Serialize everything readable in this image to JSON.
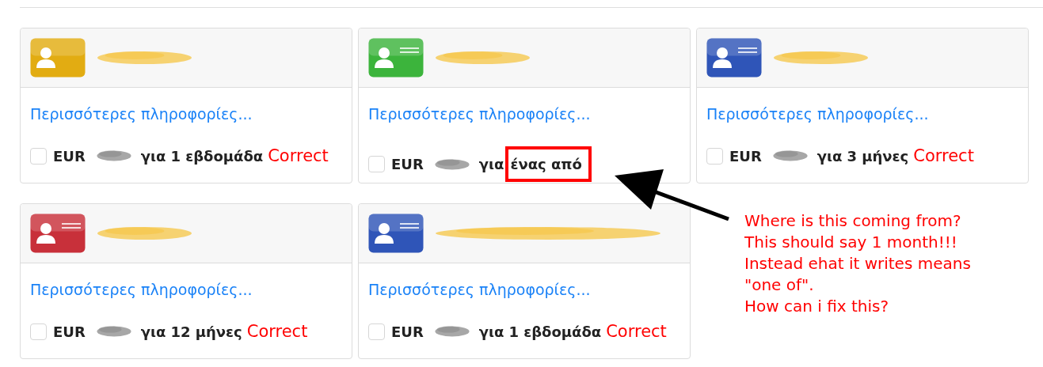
{
  "cards": [
    {
      "icon": {
        "color": "#e2ac12",
        "lines": false
      },
      "link": "Περισσότερες πληροφορίες...",
      "checked": false,
      "currency": "EUR",
      "per": "για",
      "duration": "1 εβδομάδα",
      "duration_highlighted": false,
      "note": "Correct"
    },
    {
      "icon": {
        "color": "#3cb43c",
        "lines": true
      },
      "link": "Περισσότερες πληροφορίες...",
      "checked": false,
      "currency": "EUR",
      "per": "για",
      "duration": "ένας από",
      "duration_highlighted": true
    },
    {
      "icon": {
        "color": "#2f55b8",
        "lines": true
      },
      "link": "Περισσότερες πληροφορίες...",
      "checked": false,
      "currency": "EUR",
      "per": "για",
      "duration": "3 μήνες",
      "duration_highlighted": false,
      "note": "Correct"
    },
    {
      "icon": {
        "color": "#c8303a",
        "lines": true
      },
      "link": "Περισσότερες πληροφορίες...",
      "checked": false,
      "currency": "EUR",
      "per": "για",
      "duration": "12 μήνες",
      "duration_highlighted": false,
      "note": "Correct"
    },
    {
      "icon": {
        "color": "#2f55b8",
        "lines": true
      },
      "link": "Περισσότερες πληροφορίες...",
      "checked": false,
      "currency": "EUR",
      "per": "για",
      "duration": "1 εβδομάδα",
      "duration_highlighted": false,
      "note": "Correct"
    }
  ],
  "annotation": {
    "lines": [
      "Where is this coming from?",
      "This should say 1 month!!!",
      "Instead ehat it writes means",
      "\"one of\".",
      "How can i fix this?"
    ]
  }
}
